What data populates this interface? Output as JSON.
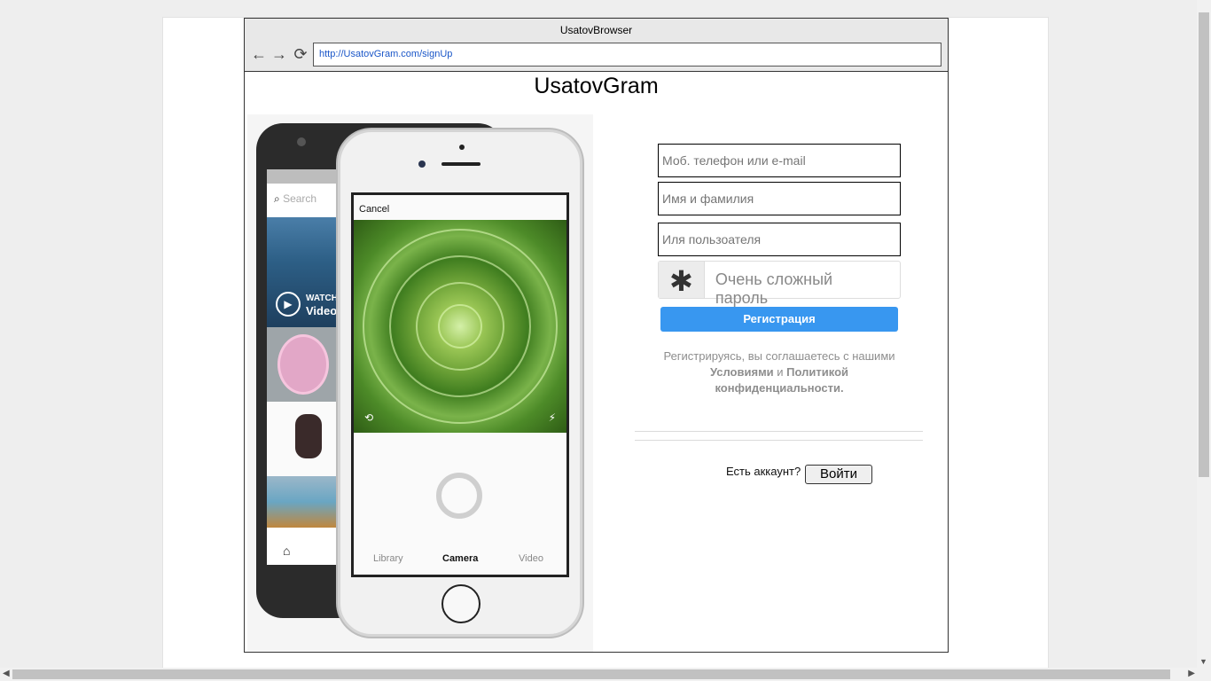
{
  "browser": {
    "title": "UsatovBrowser",
    "back_icon": "←",
    "forward_icon": "→",
    "reload_icon": "⟳",
    "url": "http://UsatovGram.com/signUp"
  },
  "app": {
    "title": "UsatovGram"
  },
  "promo": {
    "android": {
      "search_placeholder": "Search",
      "watch_label": "WATCH",
      "video_label": "Video"
    },
    "iphone": {
      "cancel_label": "Cancel",
      "modes": [
        "Library",
        "Camera",
        "Video"
      ],
      "active_mode": "Camera"
    }
  },
  "form": {
    "phone_placeholder": "Моб. телефон или e-mail",
    "name_placeholder": "Имя и фамилия",
    "username_placeholder": "Иля пользоателя",
    "password_placeholder": "Очень сложный пароль",
    "password_icon": "✱",
    "register_label": "Регистрация",
    "terms_text_1": "Регистрируясь, вы соглашаетесь с нашими ",
    "terms_link_1": "Условиями",
    "terms_text_2": " и ",
    "terms_link_2": "Политикой конфиденциальности.",
    "have_account": "Есть аккаунт?",
    "login_label": "Войти"
  },
  "colors": {
    "accent": "#3897f0",
    "url_text": "#1a56c8"
  }
}
